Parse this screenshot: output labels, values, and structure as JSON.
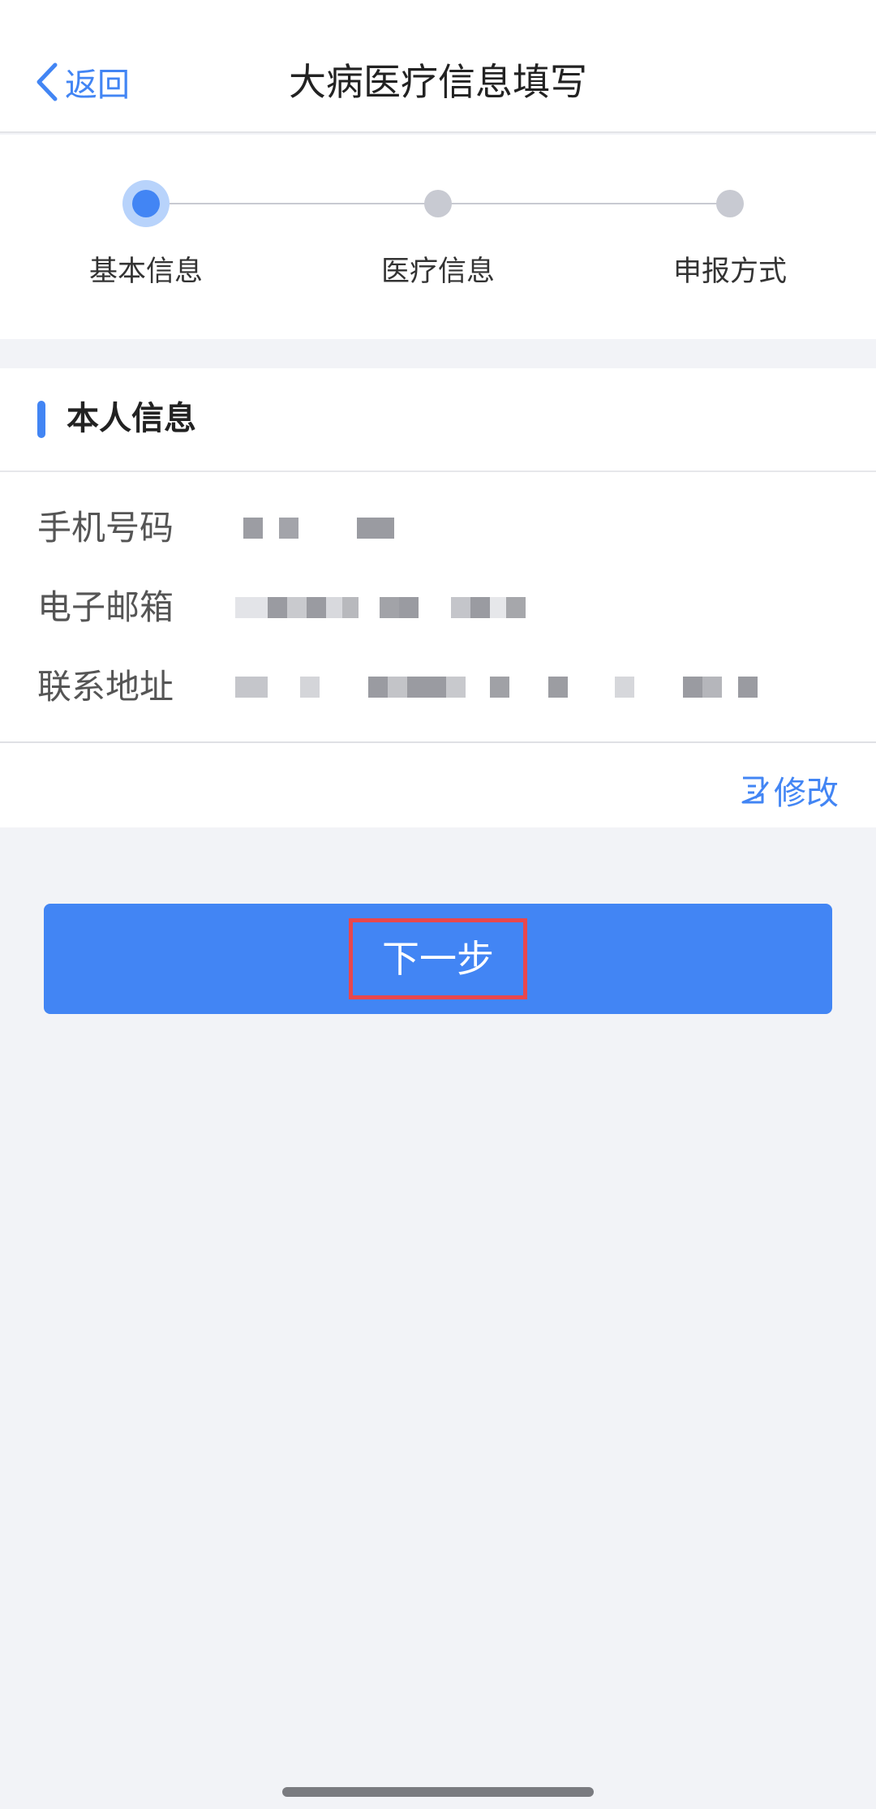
{
  "navbar": {
    "back_label": "返回",
    "title": "大病医疗信息填写"
  },
  "stepper": {
    "steps": [
      {
        "label": "基本信息",
        "active": true
      },
      {
        "label": "医疗信息",
        "active": false
      },
      {
        "label": "申报方式",
        "active": false
      }
    ]
  },
  "card": {
    "title": "本人信息",
    "rows": [
      {
        "label": "手机号码",
        "value": "(redacted)"
      },
      {
        "label": "电子邮箱",
        "value": "(redacted)"
      },
      {
        "label": "联系地址",
        "value": "(redacted)"
      }
    ],
    "edit_label": "修改"
  },
  "actions": {
    "next_label": "下一步"
  },
  "colors": {
    "accent": "#4285f4",
    "highlight_border": "#e8474d",
    "background": "#f2f3f7"
  },
  "icons": {
    "back": "chevron-left-icon",
    "edit": "edit-icon"
  }
}
